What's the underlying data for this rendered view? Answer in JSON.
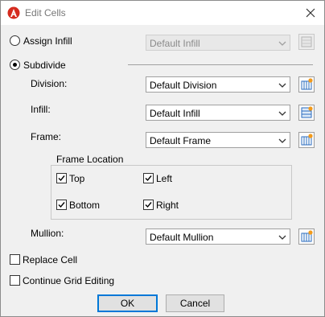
{
  "window": {
    "title": "Edit Cells"
  },
  "assign_infill": {
    "label": "Assign Infill",
    "selected": false,
    "combo_value": "Default Infill",
    "enabled": false
  },
  "subdivide": {
    "label": "Subdivide",
    "selected": true
  },
  "division": {
    "label": "Division:",
    "value": "Default Division"
  },
  "infill": {
    "label": "Infill:",
    "value": "Default Infill"
  },
  "frame": {
    "label": "Frame:",
    "value": "Default Frame"
  },
  "frame_location": {
    "title": "Frame Location",
    "top": {
      "label": "Top",
      "checked": true
    },
    "left": {
      "label": "Left",
      "checked": true
    },
    "bottom": {
      "label": "Bottom",
      "checked": true
    },
    "right": {
      "label": "Right",
      "checked": true
    }
  },
  "mullion": {
    "label": "Mullion:",
    "value": "Default Mullion"
  },
  "replace_cell": {
    "label": "Replace Cell",
    "checked": false
  },
  "continue_grid": {
    "label": "Continue Grid Editing",
    "checked": false
  },
  "buttons": {
    "ok": "OK",
    "cancel": "Cancel"
  },
  "colors": {
    "app_icon": "#d52b1e",
    "focus": "#0078d7"
  }
}
